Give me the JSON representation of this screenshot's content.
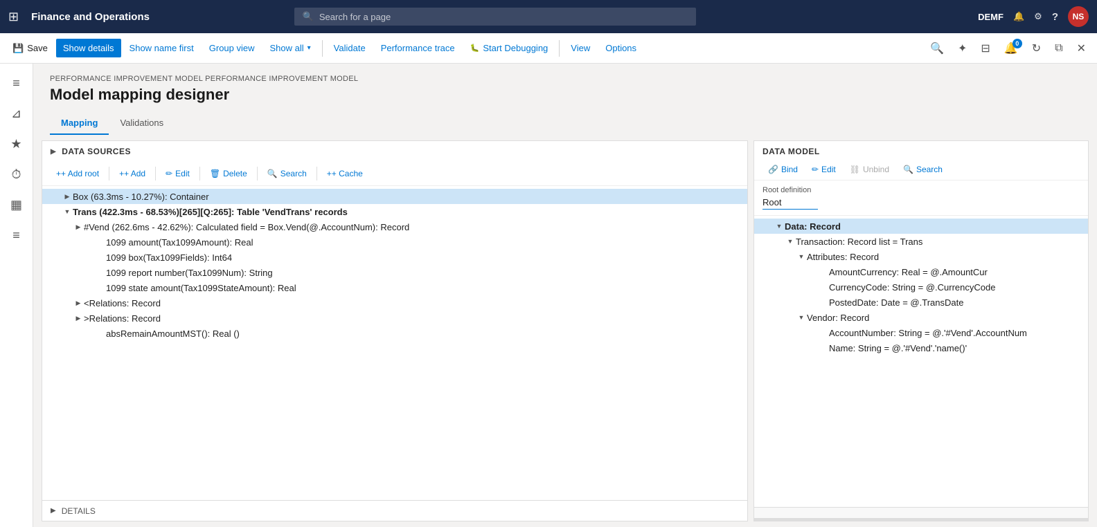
{
  "app": {
    "title": "Finance and Operations",
    "search_placeholder": "Search for a page",
    "env": "DEMF"
  },
  "toolbar": {
    "save_label": "Save",
    "show_details_label": "Show details",
    "show_name_first_label": "Show name first",
    "group_view_label": "Group view",
    "show_all_label": "Show all",
    "validate_label": "Validate",
    "perf_trace_label": "Performance trace",
    "start_debugging_label": "Start Debugging",
    "view_label": "View",
    "options_label": "Options"
  },
  "breadcrumb": "PERFORMANCE IMPROVEMENT MODEL PERFORMANCE IMPROVEMENT MODEL",
  "page_title": "Model mapping designer",
  "tabs": [
    {
      "label": "Mapping",
      "active": true
    },
    {
      "label": "Validations",
      "active": false
    }
  ],
  "data_sources": {
    "section_label": "DATA SOURCES",
    "add_root_label": "+ Add root",
    "add_label": "+ Add",
    "edit_label": "Edit",
    "delete_label": "Delete",
    "search_label": "Search",
    "cache_label": "+ Cache",
    "nodes": [
      {
        "id": "box",
        "indent": 1,
        "toggle": "▶",
        "label": "Box (63.3ms - 10.27%): Container",
        "selected": true,
        "bold": false
      },
      {
        "id": "trans",
        "indent": 1,
        "toggle": "▼",
        "label": "Trans (422.3ms - 68.53%)[265][Q:265]: Table 'VendTrans' records",
        "selected": false,
        "bold": true
      },
      {
        "id": "vend",
        "indent": 2,
        "toggle": "▶",
        "label": "#Vend (262.6ms - 42.62%): Calculated field = Box.Vend(@.AccountNum): Record",
        "selected": false,
        "bold": false
      },
      {
        "id": "tax1099amount",
        "indent": 3,
        "toggle": "",
        "label": "1099 amount(Tax1099Amount): Real",
        "selected": false,
        "bold": false
      },
      {
        "id": "tax1099fields",
        "indent": 3,
        "toggle": "",
        "label": "1099 box(Tax1099Fields): Int64",
        "selected": false,
        "bold": false
      },
      {
        "id": "tax1099num",
        "indent": 3,
        "toggle": "",
        "label": "1099 report number(Tax1099Num): String",
        "selected": false,
        "bold": false
      },
      {
        "id": "tax1099stateamount",
        "indent": 3,
        "toggle": "",
        "label": "1099 state amount(Tax1099StateAmount): Real",
        "selected": false,
        "bold": false
      },
      {
        "id": "relations1",
        "indent": 2,
        "toggle": "▶",
        "label": "<Relations: Record",
        "selected": false,
        "bold": false
      },
      {
        "id": "relations2",
        "indent": 2,
        "toggle": "▶",
        "label": ">Relations: Record",
        "selected": false,
        "bold": false
      },
      {
        "id": "absremain",
        "indent": 3,
        "toggle": "",
        "label": "absRemainAmountMST(): Real ()",
        "selected": false,
        "bold": false
      }
    ]
  },
  "data_model": {
    "section_label": "DATA MODEL",
    "bind_label": "Bind",
    "edit_label": "Edit",
    "unbind_label": "Unbind",
    "search_label": "Search",
    "root_def_label": "Root definition",
    "root_value": "Root",
    "nodes": [
      {
        "id": "data_record",
        "indent": 0,
        "toggle": "▼",
        "label": "Data: Record",
        "selected": true
      },
      {
        "id": "transaction",
        "indent": 1,
        "toggle": "▼",
        "label": "Transaction: Record list = Trans",
        "selected": false
      },
      {
        "id": "attributes",
        "indent": 2,
        "toggle": "▼",
        "label": "Attributes: Record",
        "selected": false
      },
      {
        "id": "amount_currency",
        "indent": 3,
        "toggle": "",
        "label": "AmountCurrency: Real = @.AmountCur",
        "selected": false
      },
      {
        "id": "currency_code",
        "indent": 3,
        "toggle": "",
        "label": "CurrencyCode: String = @.CurrencyCode",
        "selected": false
      },
      {
        "id": "posted_date",
        "indent": 3,
        "toggle": "",
        "label": "PostedDate: Date = @.TransDate",
        "selected": false
      },
      {
        "id": "vendor",
        "indent": 2,
        "toggle": "▼",
        "label": "Vendor: Record",
        "selected": false
      },
      {
        "id": "account_number",
        "indent": 3,
        "toggle": "",
        "label": "AccountNumber: String = @.'#Vend'.AccountNum",
        "selected": false
      },
      {
        "id": "name",
        "indent": 3,
        "toggle": "",
        "label": "Name: String = @.'#Vend'.'name()'",
        "selected": false
      }
    ]
  },
  "details_bar": {
    "toggle": "▶",
    "label": "DETAILS"
  },
  "icons": {
    "grid": "⊞",
    "search": "🔍",
    "bell": "🔔",
    "settings": "⚙",
    "help": "?",
    "filter": "⊿",
    "home": "⌂",
    "star": "★",
    "clock": "⏱",
    "table": "▦",
    "list": "≡",
    "save": "💾",
    "debug": "🐛",
    "link": "🔗",
    "pencil": "✏",
    "trash": "🗑",
    "chain": "🔗",
    "pin": "📌",
    "refresh": "↻",
    "newwindow": "⧉",
    "close": "✕",
    "expand": "⤢"
  }
}
